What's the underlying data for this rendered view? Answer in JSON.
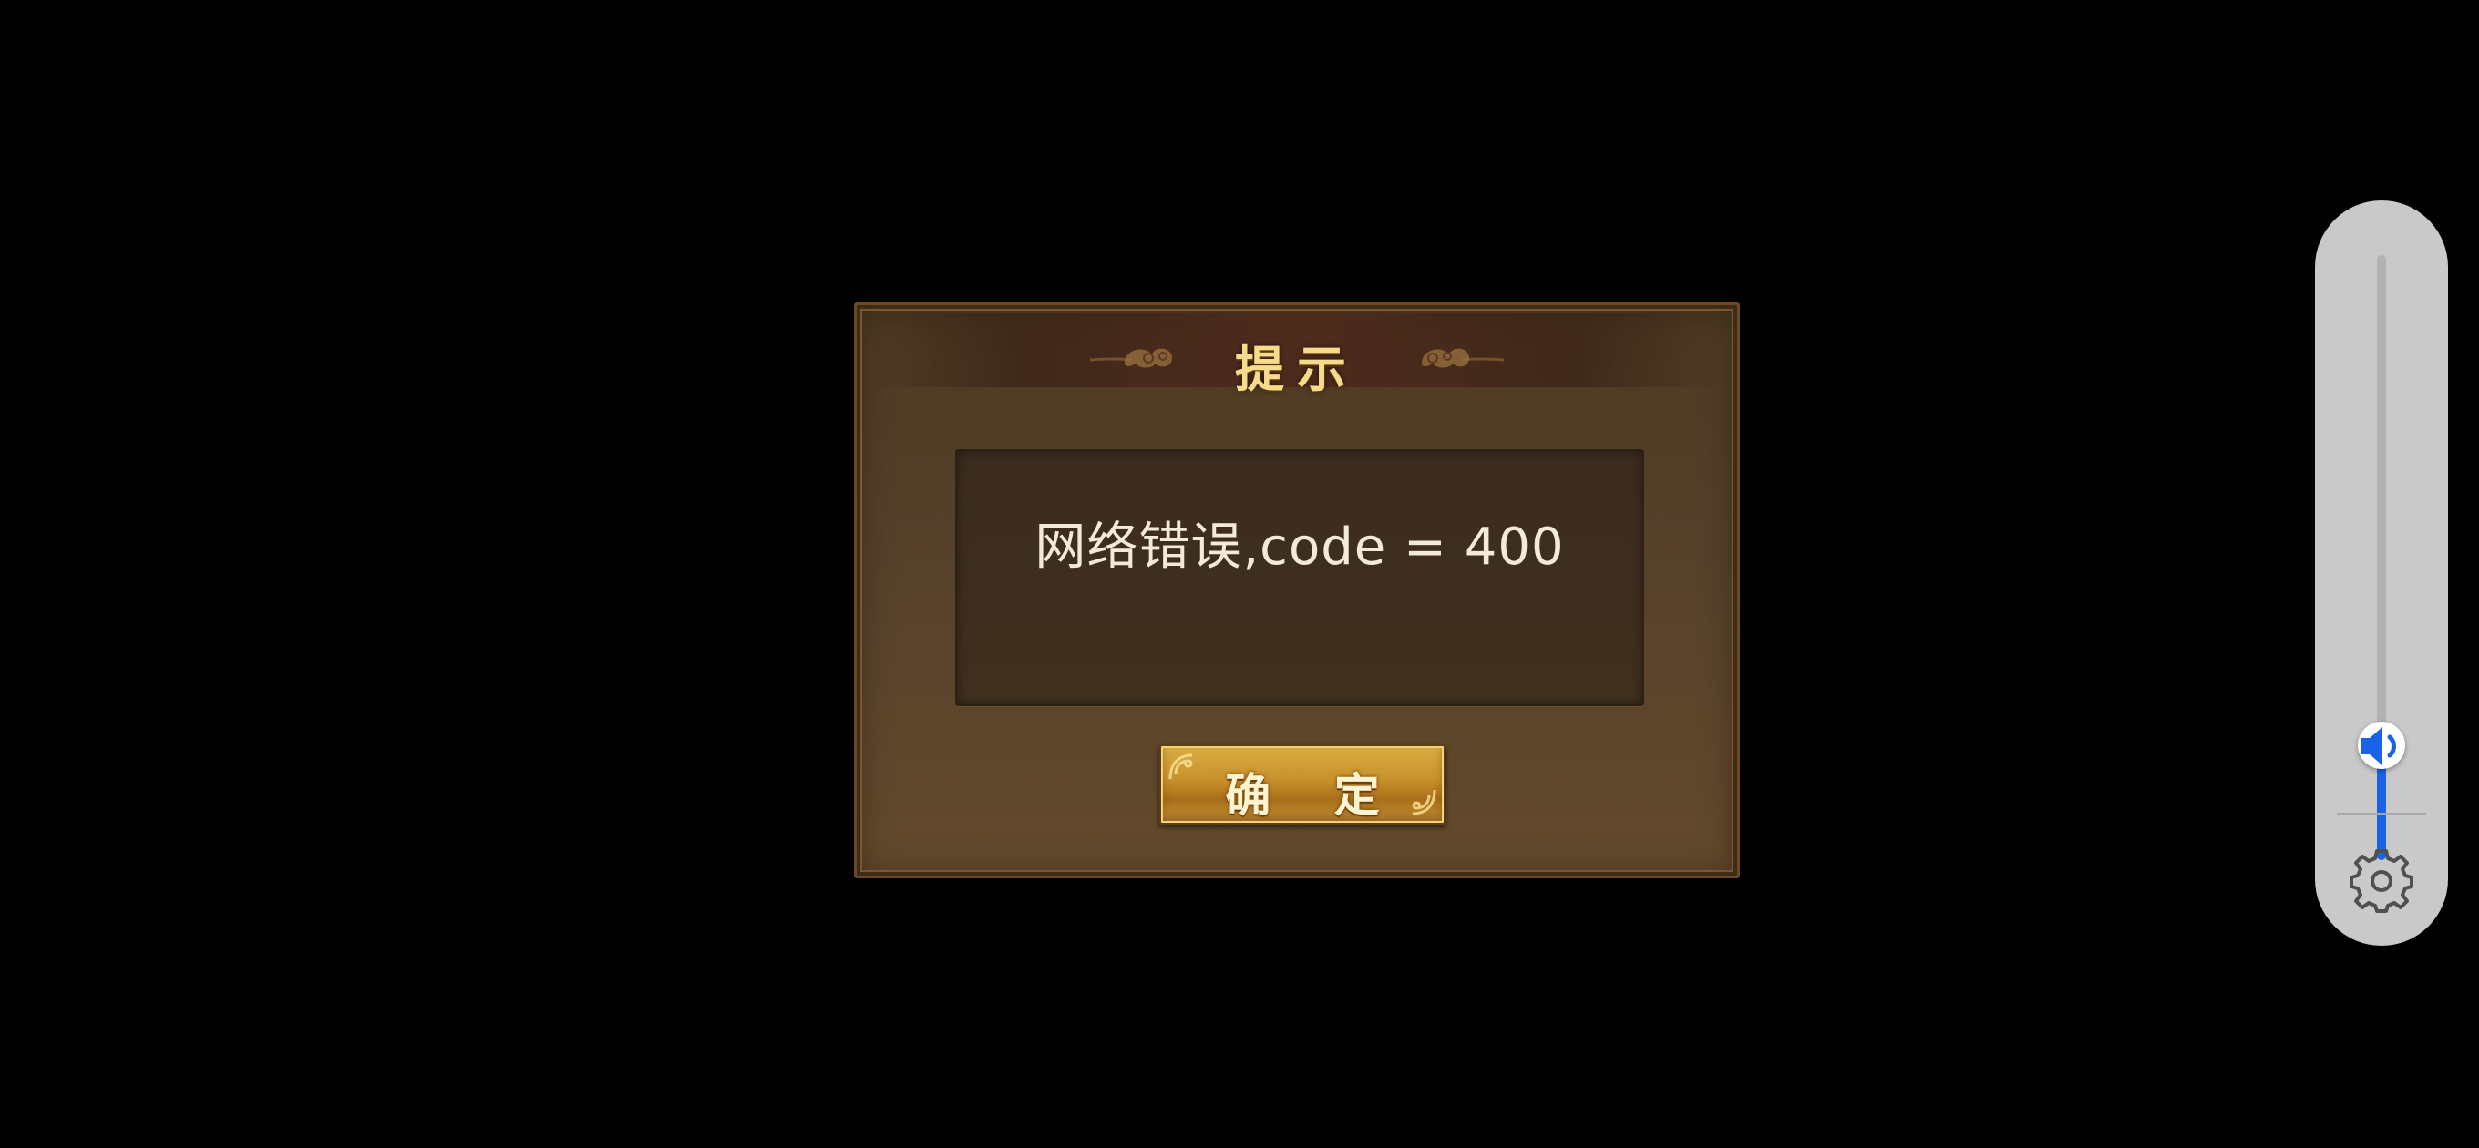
{
  "dialog": {
    "title": "提示",
    "message": "网络错误,code = 400",
    "confirm_label": "确 定",
    "title_color": "#f6dc8a",
    "message_color": "#f4ead8"
  },
  "volume_panel": {
    "level": 0.19,
    "accent_color": "#1a62e8",
    "icons": {
      "speaker": "speaker-icon",
      "settings": "gear-icon"
    }
  }
}
